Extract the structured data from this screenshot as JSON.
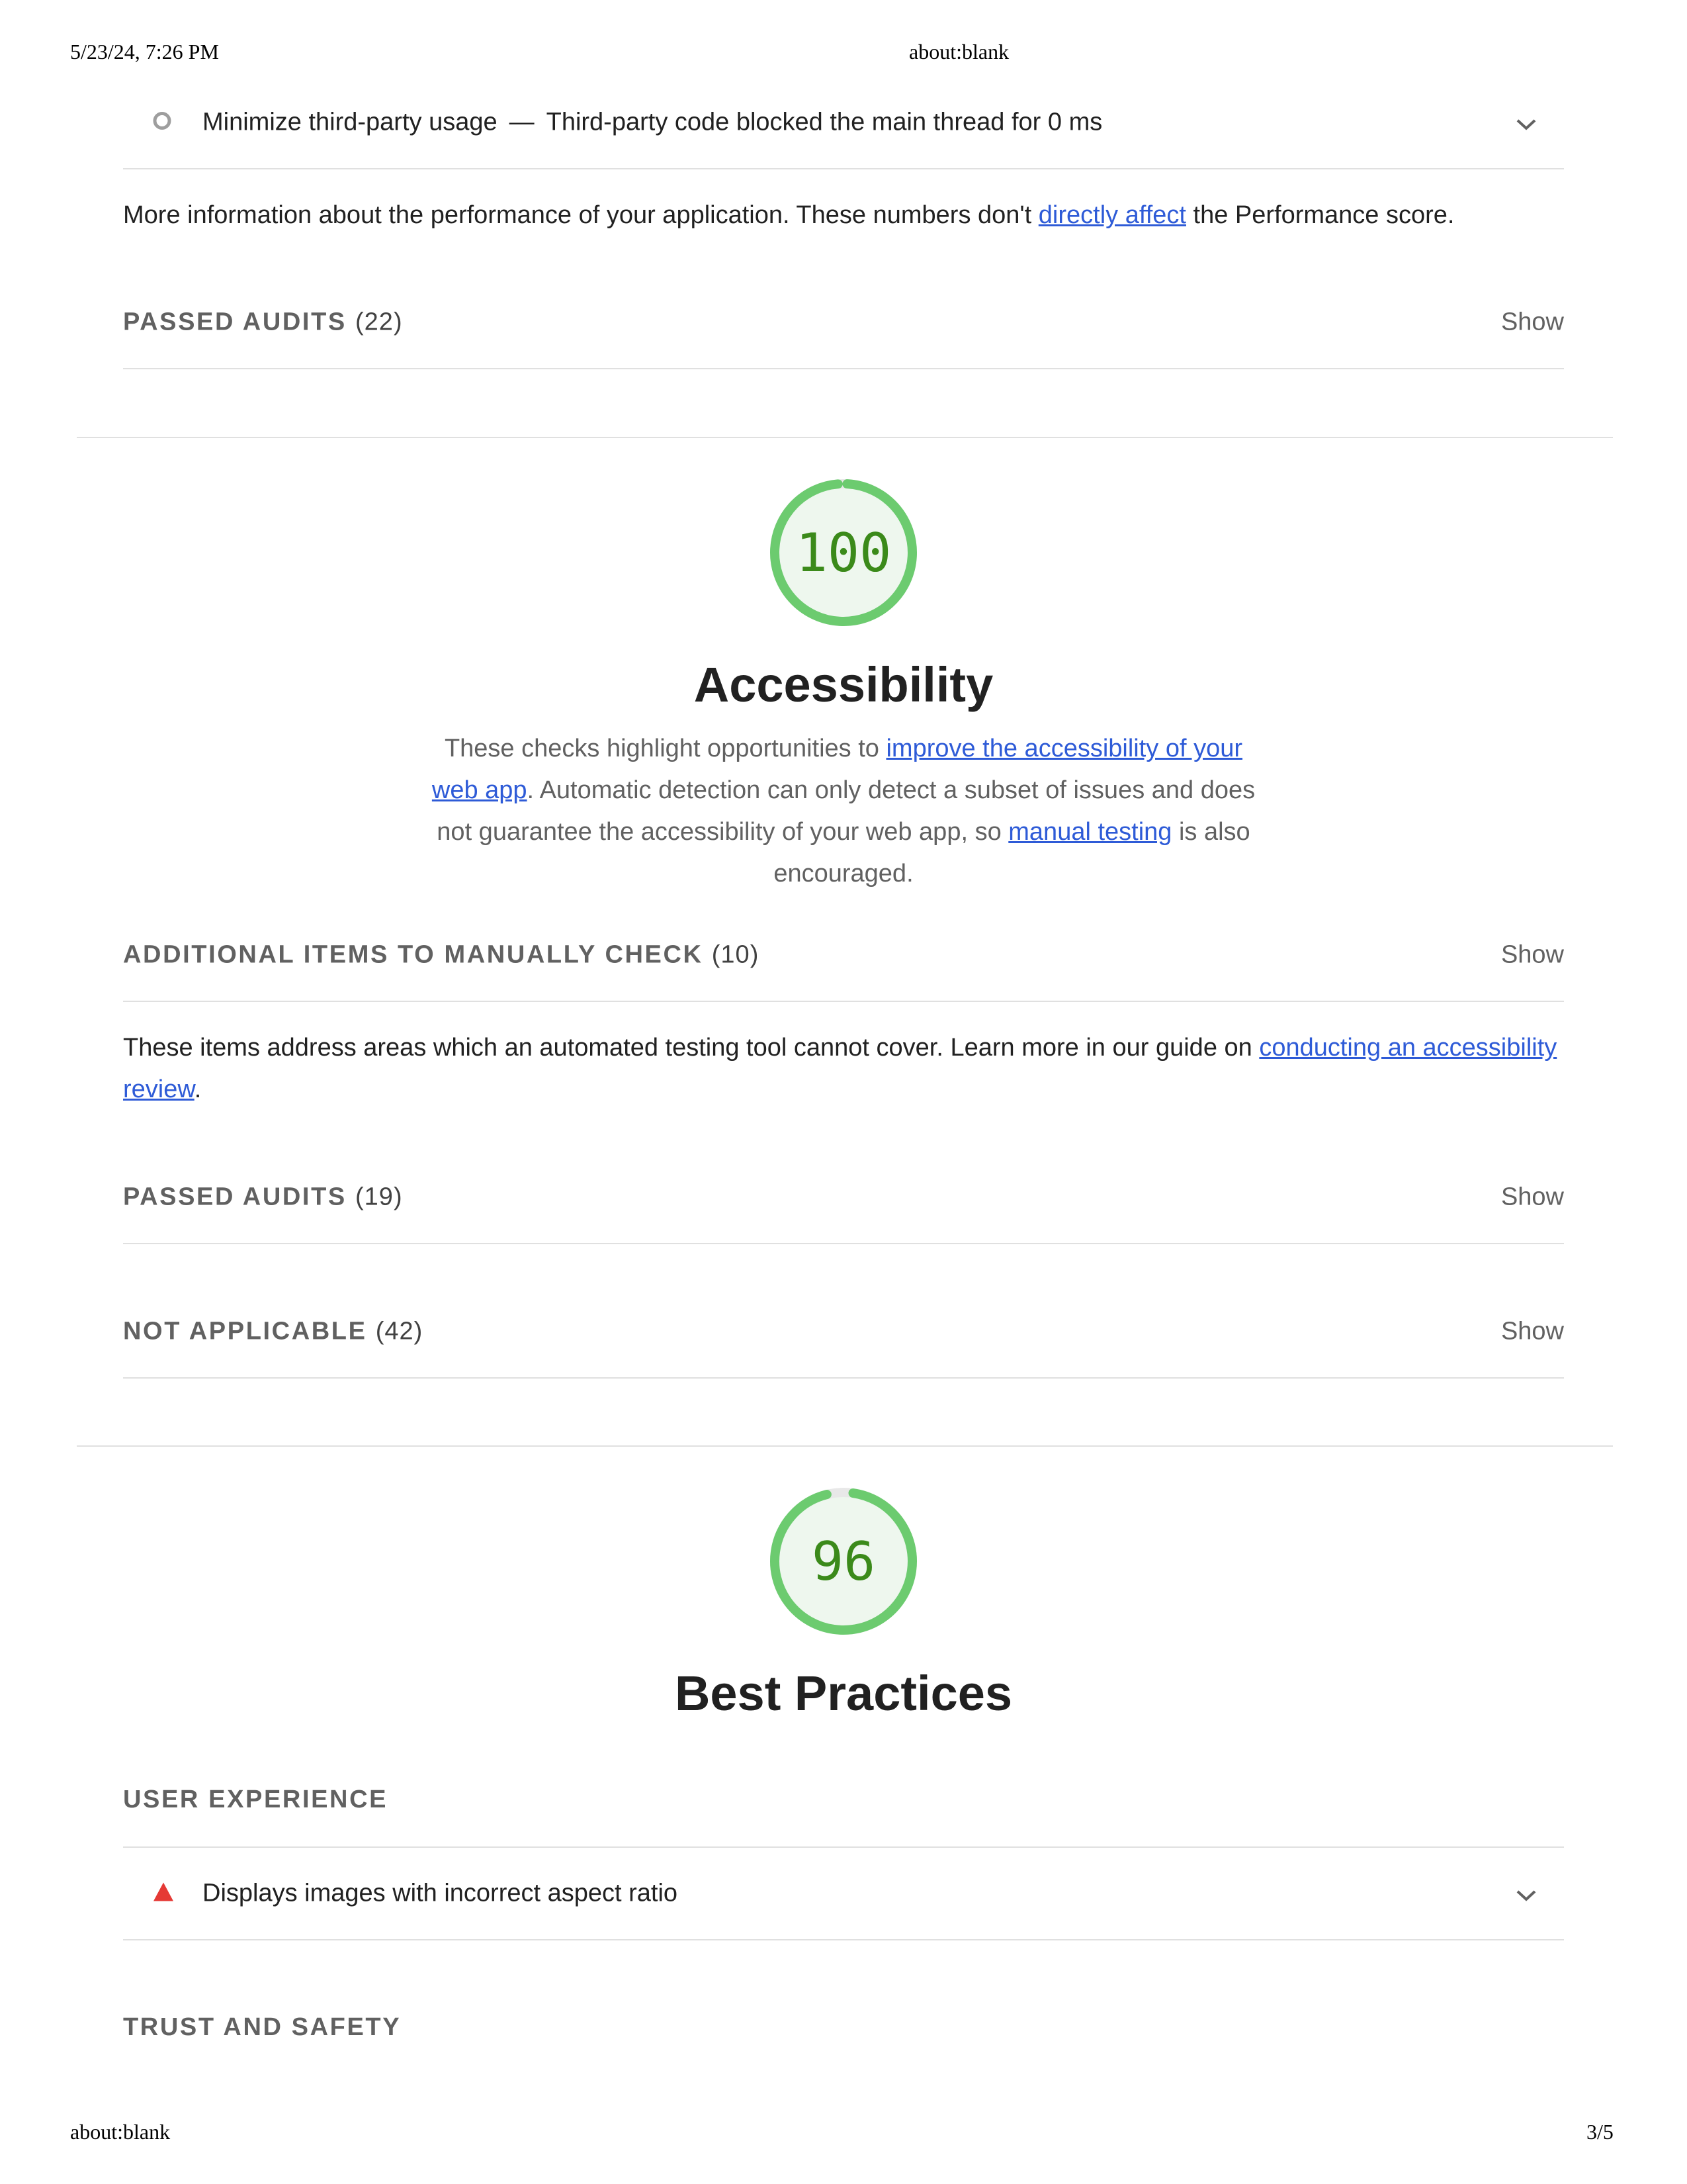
{
  "print_header": {
    "datetime": "5/23/24, 7:26 PM",
    "url": "about:blank"
  },
  "print_footer": {
    "url": "about:blank",
    "page": "3/5"
  },
  "performance": {
    "audit_third_party": {
      "title": "Minimize third-party usage",
      "separator": "—",
      "display_value": "Third-party code blocked the main thread for 0 ms"
    },
    "diagnostics_note": {
      "before": "More information about the performance of your application. These numbers don't ",
      "link": "directly affect",
      "after": " the Performance score."
    },
    "passed_audits": {
      "label": "Passed audits",
      "count": "(22)",
      "toggle": "Show"
    }
  },
  "accessibility": {
    "score": "100",
    "score_fraction": 1.0,
    "title": "Accessibility",
    "description": {
      "p1": "These checks highlight opportunities to ",
      "link1": "improve the accessibility of your web app",
      "p2": ". Automatic detection can only detect a subset of issues and does not guarantee the accessibility of your web app, so ",
      "link2": "manual testing",
      "p3": " is also encouraged."
    },
    "manual_check": {
      "label": "Additional items to manually check",
      "count": "(10)",
      "toggle": "Show"
    },
    "manual_note": {
      "before": "These items address areas which an automated testing tool cannot cover. Learn more in our guide on ",
      "link": "conducting an accessibility review",
      "after": "."
    },
    "passed_audits": {
      "label": "Passed audits",
      "count": "(19)",
      "toggle": "Show"
    },
    "not_applicable": {
      "label": "Not applicable",
      "count": "(42)",
      "toggle": "Show"
    }
  },
  "best_practices": {
    "score": "96",
    "score_fraction": 0.96,
    "title": "Best Practices",
    "group_user_experience": "User experience",
    "audit_aspect_ratio": {
      "title": "Displays images with incorrect aspect ratio"
    },
    "group_trust_safety": "Trust and safety"
  },
  "colors": {
    "pass": "#0cce6b",
    "gauge_arc": "#6ccb6f",
    "gauge_fill": "#eef7ee",
    "fail": "#e53935",
    "link": "#2e5bd7"
  }
}
